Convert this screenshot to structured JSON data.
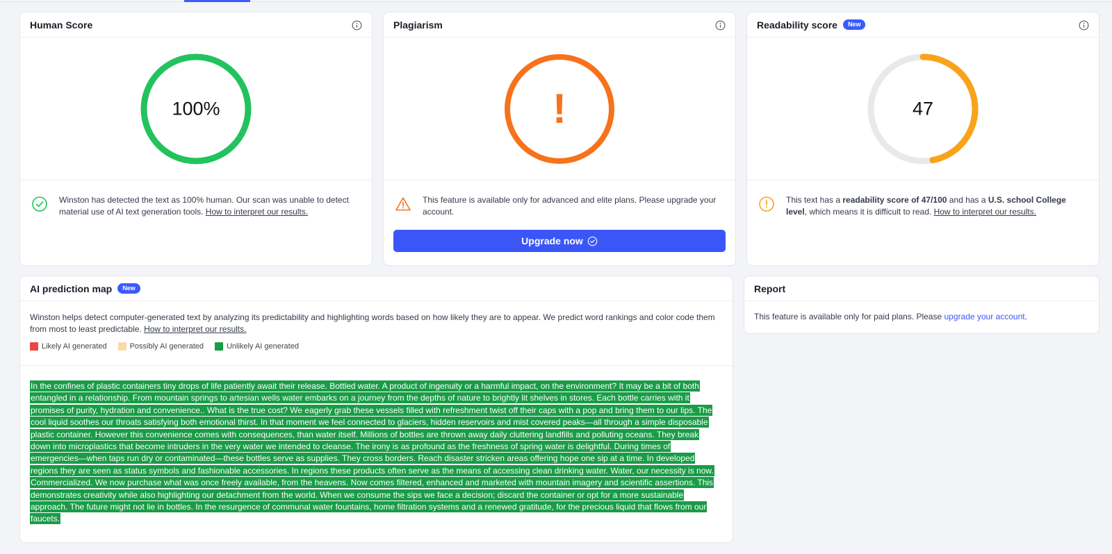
{
  "human_score": {
    "title": "Human Score",
    "value_text": "100%",
    "value": 100,
    "ring_color": "#22c35e",
    "message_prefix": "Winston has detected the text as 100% human. Our scan was unable to detect material use of AI text generation tools.",
    "link": "How to interpret our results."
  },
  "plagiarism": {
    "title": "Plagiarism",
    "ring_color": "#f6721b",
    "symbol": "!",
    "message": "This feature is available only for advanced and elite plans. Please upgrade your account.",
    "button_label": "Upgrade now"
  },
  "readability": {
    "title": "Readability score",
    "badge": "New",
    "value_text": "47",
    "value": 47,
    "max": 100,
    "ring_color": "#f9a31b",
    "track_color": "#e9e9ec",
    "msg_1": "This text has a ",
    "msg_bold_1": "readability score of 47/100",
    "msg_2": " and has a ",
    "msg_bold_2": "U.S. school College level",
    "msg_3": ", which means it is difficult to read. ",
    "link": "How to interpret our results."
  },
  "prediction_map": {
    "title": "AI prediction map",
    "badge": "New",
    "intro": "Winston helps detect computer-generated text by analyzing its predictability and highlighting words based on how likely they are to appear. We predict word rankings and color code them from most to least predictable. ",
    "link": "How to interpret our results.",
    "legend": [
      {
        "label": "Likely AI generated",
        "color": "#ef4444"
      },
      {
        "label": "Possibly AI generated",
        "color": "#fbd9a8"
      },
      {
        "label": "Unlikely AI generated",
        "color": "#1a9c47"
      }
    ],
    "analyzed_text": "In the confines of plastic containers tiny drops of life patiently await their release. Bottled water. A product of ingenuity or a harmful impact, on the environment? It may be a bit of both entangled in a relationship. From mountain springs to artesian wells water embarks on a journey from the depths of nature to brightly lit shelves in stores. Each bottle carries with it promises of purity, hydration and convenience.. What is the true cost? We eagerly grab these vessels filled with refreshment twist off their caps with a pop and bring them to our lips. The cool liquid soothes our throats satisfying both emotional thirst. In that moment we feel connected to glaciers, hidden reservoirs and mist covered peaks—all through a simple disposable plastic container. However this convenience comes with consequences, than water itself. Millions of bottles are thrown away daily cluttering landfills and polluting oceans. They break down into microplastics that become intruders in the very water we intended to cleanse. The irony is as profound as the freshness of spring water is delightful. During times of emergencies—when taps run dry or contaminated—these bottles serve as supplies. They cross borders. Reach disaster stricken areas offering hope one sip at a time. In developed regions they are seen as status symbols and fashionable accessories. In regions these products often serve as the means of accessing clean drinking water. Water, our necessity is now. Commercialized. We now purchase what was once freely available, from the heavens. Now comes filtered, enhanced and marketed with mountain imagery and scientific assertions. This demonstrates creativity while also highlighting our detachment from the world. When we consume the sips we face a decision; discard the container or opt for a more sustainable approach. The future might not lie in bottles. In the resurgence of communal water fountains, home filtration systems and a renewed gratitude, for the precious liquid that flows from our faucets."
  },
  "report": {
    "title": "Report",
    "message": "This feature is available only for paid plans. Please ",
    "link": "upgrade your account",
    "suffix": "."
  }
}
